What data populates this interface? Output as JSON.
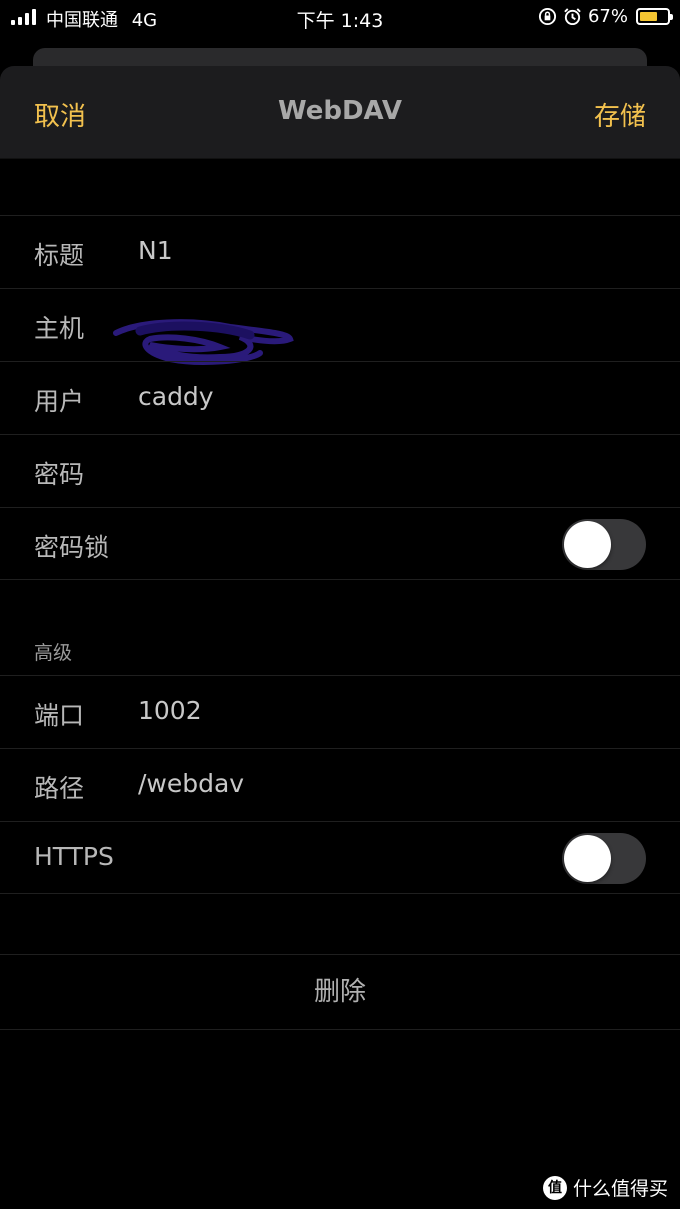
{
  "status_bar": {
    "carrier": "中国联通",
    "network": "4G",
    "time": "下午 1:43",
    "battery_percent": "67%",
    "battery_level": 0.67,
    "battery_color": "#f4c531"
  },
  "navbar": {
    "cancel_label": "取消",
    "title": "WebDAV",
    "save_label": "存储",
    "accent_color": "#f2c14e"
  },
  "basic": {
    "rows": [
      {
        "label": "标题",
        "value": "N1"
      },
      {
        "label": "主机",
        "value": ""
      },
      {
        "label": "用户",
        "value": "caddy"
      },
      {
        "label": "密码",
        "value": ""
      },
      {
        "label": "密码锁",
        "toggle": false
      }
    ]
  },
  "advanced": {
    "header": "高级",
    "rows": [
      {
        "label": "端口",
        "value": "1002"
      },
      {
        "label": "路径",
        "value": "/webdav"
      },
      {
        "label": "HTTPS",
        "toggle": false
      }
    ]
  },
  "delete_label": "删除",
  "watermark": {
    "badge": "值",
    "text": "什么值得买"
  },
  "icons": [
    "signal-icon",
    "lock-rotation-icon",
    "alarm-icon",
    "battery-icon",
    "redaction-scribble"
  ]
}
